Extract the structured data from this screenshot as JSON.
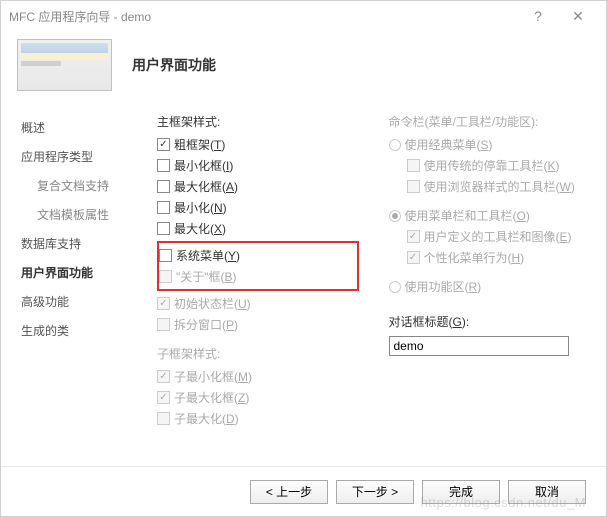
{
  "window": {
    "title": "MFC 应用程序向导 - demo"
  },
  "header": {
    "title": "用户界面功能"
  },
  "sidebar": {
    "items": [
      {
        "label": "概述"
      },
      {
        "label": "应用程序类型"
      },
      {
        "label": "复合文档支持"
      },
      {
        "label": "文档模板属性"
      },
      {
        "label": "数据库支持"
      },
      {
        "label": "用户界面功能"
      },
      {
        "label": "高级功能"
      },
      {
        "label": "生成的类"
      }
    ]
  },
  "main": {
    "label": "主框架样式:",
    "thick": "粗框架(T)",
    "minbox": "最小化框(I)",
    "maxbox": "最大化框(A)",
    "minimized": "最小化(N)",
    "maximized": "最大化(X)",
    "sysmenu": "系统菜单(Y)",
    "about": "\"关于\"框(B)",
    "statusbar": "初始状态栏(U)",
    "split": "拆分窗口(P)"
  },
  "child": {
    "label": "子框架样式:",
    "minbox": "子最小化框(M)",
    "maxbox": "子最大化框(Z)",
    "maximized": "子最大化(D)"
  },
  "cmdbar": {
    "label": "命令栏(菜单/工具栏/功能区):",
    "classic": "使用经典菜单(S)",
    "dockbars": "使用传统的停靠工具栏(K)",
    "browserbars": "使用浏览器样式的工具栏(W)",
    "menubar": "使用菜单栏和工具栏(O)",
    "userimg": "用户定义的工具栏和图像(E)",
    "personal": "个性化菜单行为(H)",
    "ribbon": "使用功能区(R)"
  },
  "dlgTitle": {
    "label": "对话框标题(G):",
    "value": "demo"
  },
  "buttons": {
    "prev": "< 上一步",
    "next": "下一步 >",
    "finish": "完成",
    "cancel": "取消"
  },
  "watermark": "https://blog.csdn.net/du_M"
}
